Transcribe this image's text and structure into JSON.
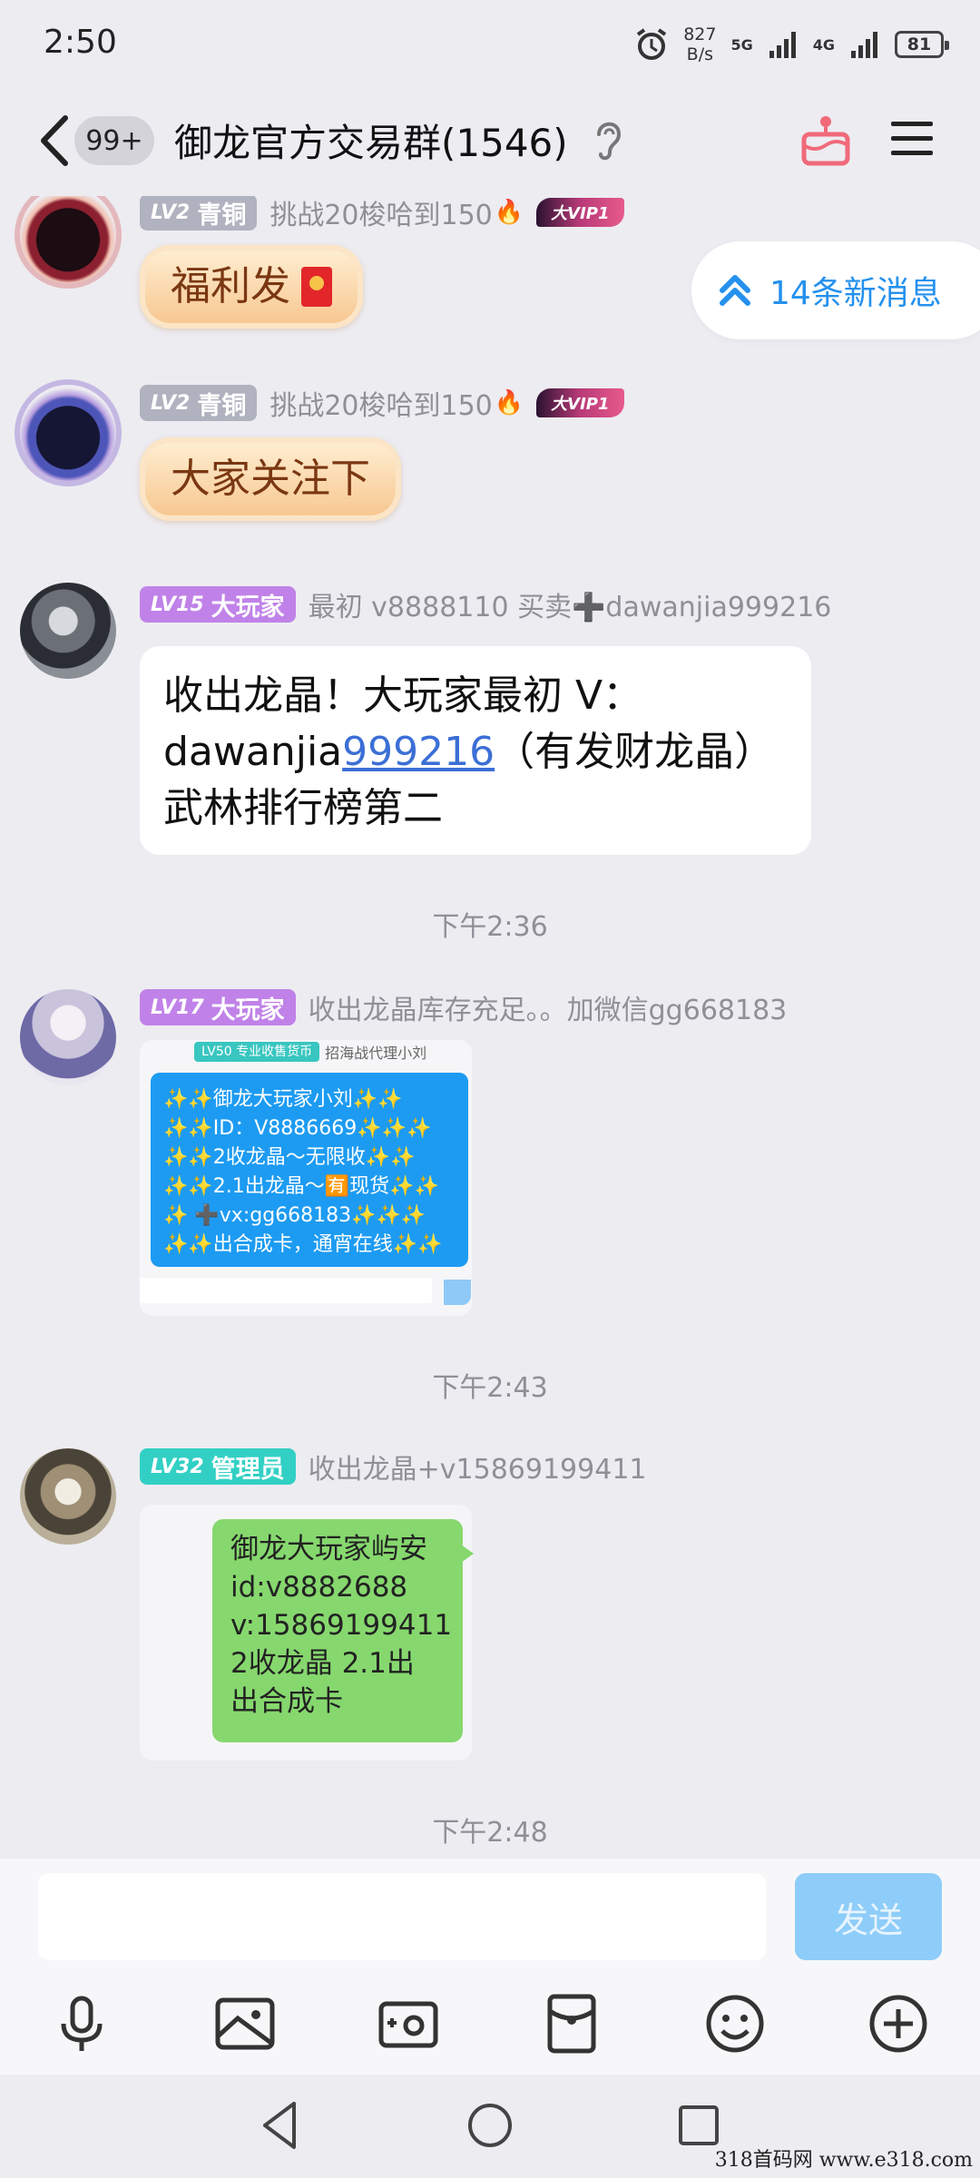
{
  "status_bar": {
    "time": "2:50",
    "net_speed_value": "827",
    "net_speed_unit": "B/s",
    "signal1": "5G",
    "signal2": "4G",
    "battery": "81"
  },
  "header": {
    "unread_badge": "99+",
    "title": "御龙官方交易群(1546)"
  },
  "new_messages_pill": "14条新消息",
  "messages": [
    {
      "level": "LV2",
      "title": "青铜",
      "nickname": "挑战20梭哈到150",
      "vip": "大VIP1",
      "text": "福利发"
    },
    {
      "level": "LV2",
      "title": "青铜",
      "nickname": "挑战20梭哈到150",
      "vip": "大VIP1",
      "text": "大家关注下"
    },
    {
      "level": "LV15",
      "title": "大玩家",
      "nickname": "最初 v8888110 买卖➕dawanjia999216",
      "line1": "收出龙晶！大玩家最初 V：",
      "line2_a": "dawanjia",
      "line2_link": "999216",
      "line2_b": "（有发财龙晶）",
      "line3": "武林排行榜第二"
    },
    {
      "time": "下午2:36"
    },
    {
      "level": "LV17",
      "title": "大玩家",
      "nickname": "收出龙晶库存充足。。加微信gg668183",
      "image": {
        "badge": "LV50 专业收售货币",
        "nick": "招海战代理小刘",
        "lines": [
          "✨✨御龙大玩家小刘✨✨",
          "✨✨ID：V8886669✨✨✨",
          "✨✨2收龙晶～无限收✨✨",
          "✨✨2.1出龙晶～🈶现货✨✨",
          "✨ ➕vx:gg668183✨✨✨",
          "✨✨出合成卡，通宵在线✨✨"
        ]
      }
    },
    {
      "time": "下午2:43"
    },
    {
      "level": "LV32",
      "title": "管理员",
      "nickname": "收出龙晶+v15869199411",
      "image": {
        "lines": [
          "御龙大玩家屿安",
          "id:v8882688",
          "v:15869199411",
          "2收龙晶 2.1出",
          "出合成卡"
        ]
      }
    },
    {
      "time": "下午2:48"
    }
  ],
  "input": {
    "placeholder": "",
    "send_label": "发送"
  },
  "watermark": "318首码网  www.e318.com"
}
